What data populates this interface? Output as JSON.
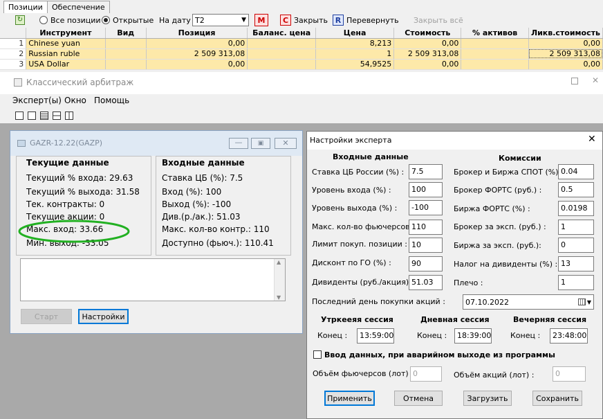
{
  "top": {
    "tabs": [
      "Позиции",
      "Обеспечение"
    ],
    "toolbar": {
      "all_positions": "Все позиции",
      "open": "Открытые",
      "on_date": "На дату",
      "date_value": "T2",
      "m_label": "M",
      "c_label": "C",
      "close": "Закрыть",
      "r_label": "R",
      "flip": "Перевернуть",
      "close_all": "Закрыть всё"
    },
    "columns": [
      "Инструмент",
      "Вид",
      "Позиция",
      "Баланс. цена",
      "Цена",
      "Стоимость",
      "% активов",
      "Ликв.стоимость"
    ],
    "rows": [
      {
        "idx": "1",
        "instrument": "Chinese yuan",
        "kind": "",
        "position": "0,00",
        "balance": "",
        "price": "8,213",
        "cost": "0,00",
        "pct": "",
        "liq": "0,00"
      },
      {
        "idx": "2",
        "instrument": "Russian ruble",
        "kind": "",
        "position": "2 509 313,08",
        "balance": "",
        "price": "1",
        "cost": "2 509 313,08",
        "pct": "",
        "liq": "2 509 313,08"
      },
      {
        "idx": "3",
        "instrument": "USA Dollar",
        "kind": "",
        "position": "0,00",
        "balance": "",
        "price": "54,9525",
        "cost": "0,00",
        "pct": "",
        "liq": "0,00"
      }
    ]
  },
  "arb": {
    "title": "Классический арбитраж",
    "menu": [
      "Эксперт(ы)",
      "Окно",
      "Помощь"
    ]
  },
  "gazr": {
    "title": "GAZR-12.22(GAZP)",
    "current_header": "Текущие данные",
    "current": [
      "Текущий % входа: 29.63",
      "Текущий % выхода: 31.58",
      "Тек. контракты: 0",
      "Текущие акции: 0",
      "Макс. вход: 33.66",
      "Мин. выход: -33.05"
    ],
    "input_header": "Входные данные",
    "input": [
      "Ставка ЦБ (%): 7.5",
      "Вход (%): 100",
      "Выход (%): -100",
      "Див.(р./ак.): 51.03",
      "Макс. кол-во контр.: 110",
      "Доступно (фьюч.): 110.41"
    ],
    "start": "Старт",
    "settings": "Настройки"
  },
  "dialog": {
    "title": "Настройки эксперта",
    "input_header": "Входные данные",
    "commissions_header": "Комиссии",
    "left_fields": [
      {
        "label": "Ставка ЦБ России (%) :",
        "value": "7.5"
      },
      {
        "label": "Уровень входа (%) :",
        "value": "100"
      },
      {
        "label": "Уровень выхода (%) :",
        "value": "-100"
      },
      {
        "label": "Макс. кол-во фьючерсов :",
        "value": "110"
      },
      {
        "label": "Лимит покуп. позиции :",
        "value": "10"
      },
      {
        "label": "Дисконт по ГО (%) :",
        "value": "90"
      },
      {
        "label": "Дивиденты (руб./акция) :",
        "value": "51.03"
      }
    ],
    "right_fields": [
      {
        "label": "Брокер и Биржа СПОТ (%):",
        "value": "0.04"
      },
      {
        "label": "Брокер ФОРТС (руб.) :",
        "value": "0.5"
      },
      {
        "label": "Биржа ФОРТС (%) :",
        "value": "0.0198"
      },
      {
        "label": "Брокер за эксп. (руб.) :",
        "value": "1"
      },
      {
        "label": "Биржа за эксп. (руб.):",
        "value": "0"
      },
      {
        "label": "Налог на дивиденты (%) :",
        "value": "13"
      },
      {
        "label": "Плечо :",
        "value": "1"
      }
    ],
    "last_day_label": "Последний день покупки акций :",
    "last_day_value": "07.10.2022",
    "sessions": [
      {
        "title": "Утркеeяя сессия",
        "end_label": "Конец :",
        "end": "13:59:00"
      },
      {
        "title": "Дневная сессия",
        "end_label": "Конец :",
        "end": "18:39:00"
      },
      {
        "title": "Вечерняя сессия",
        "end_label": "Конец :",
        "end": "23:48:00"
      }
    ],
    "emergency_label": "Ввод данных, при аварийном выходе из программы",
    "futures_vol_label": "Объём фьючерсов (лот) :",
    "futures_vol": "0",
    "shares_vol_label": "Объём акций (лот) :",
    "shares_vol": "0",
    "apply": "Применить",
    "cancel": "Отмена",
    "load": "Загрузить",
    "save": "Сохранить"
  }
}
